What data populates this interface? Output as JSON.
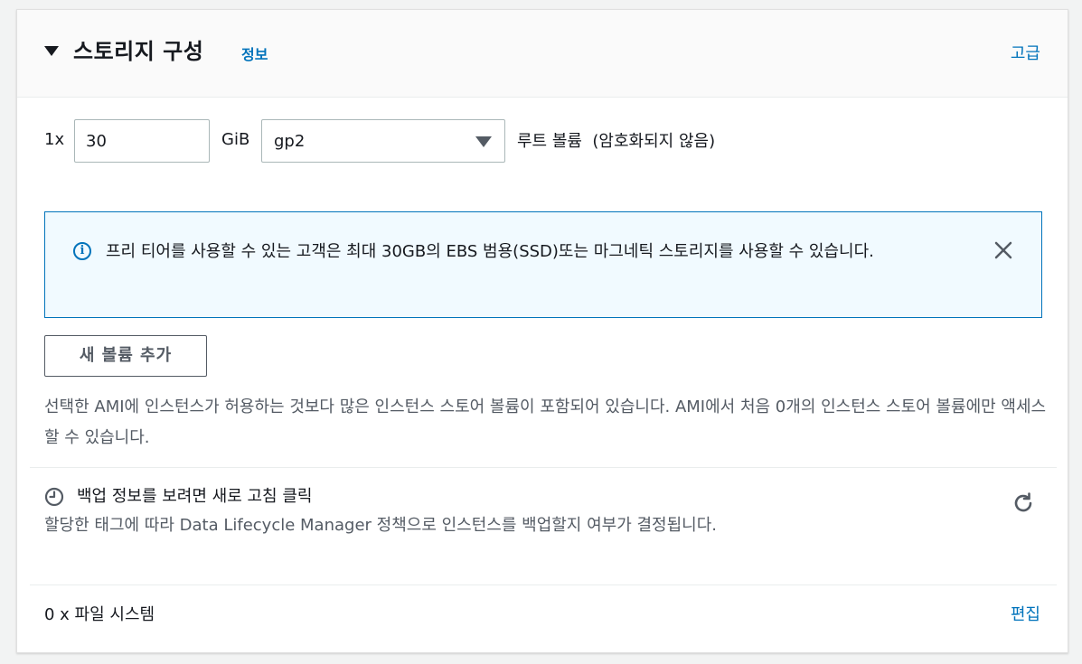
{
  "header": {
    "title": "스토리지 구성",
    "info_link": "정보",
    "advanced_link": "고급"
  },
  "volume": {
    "count_label": "1x",
    "size_value": "30",
    "unit": "GiB",
    "type_value": "gp2",
    "description": "루트 볼륨  (암호화되지 않음)"
  },
  "alert": {
    "message": "프리 티어를 사용할 수 있는 고객은 최대 30GB의 EBS 범용(SSD)또는 마그네틱 스토리지를 사용할 수 있습니다."
  },
  "add_volume_button": "새 볼륨 추가",
  "ami_note": "선택한 AMI에 인스턴스가 허용하는 것보다 많은 인스턴스 스토어 볼륨이 포함되어 있습니다. AMI에서 처음 0개의 인스턴스 스토어 볼륨에만 액세스할 수 있습니다.",
  "backup": {
    "title": "백업 정보를 보려면 새로 고침 클릭",
    "description": "할당한 태그에 따라 Data Lifecycle Manager 정책으로 인스턴스를 백업할지 여부가 결정됩니다."
  },
  "file_system": {
    "label": "0 x 파일 시스템",
    "edit_link": "편집"
  },
  "colors": {
    "link": "#0073bb",
    "alert_bg": "#f1faff",
    "text_primary": "#16191f",
    "text_secondary": "#545b64"
  },
  "icons": [
    "caret-down-icon",
    "info-icon",
    "close-icon",
    "clock-icon",
    "refresh-icon"
  ]
}
